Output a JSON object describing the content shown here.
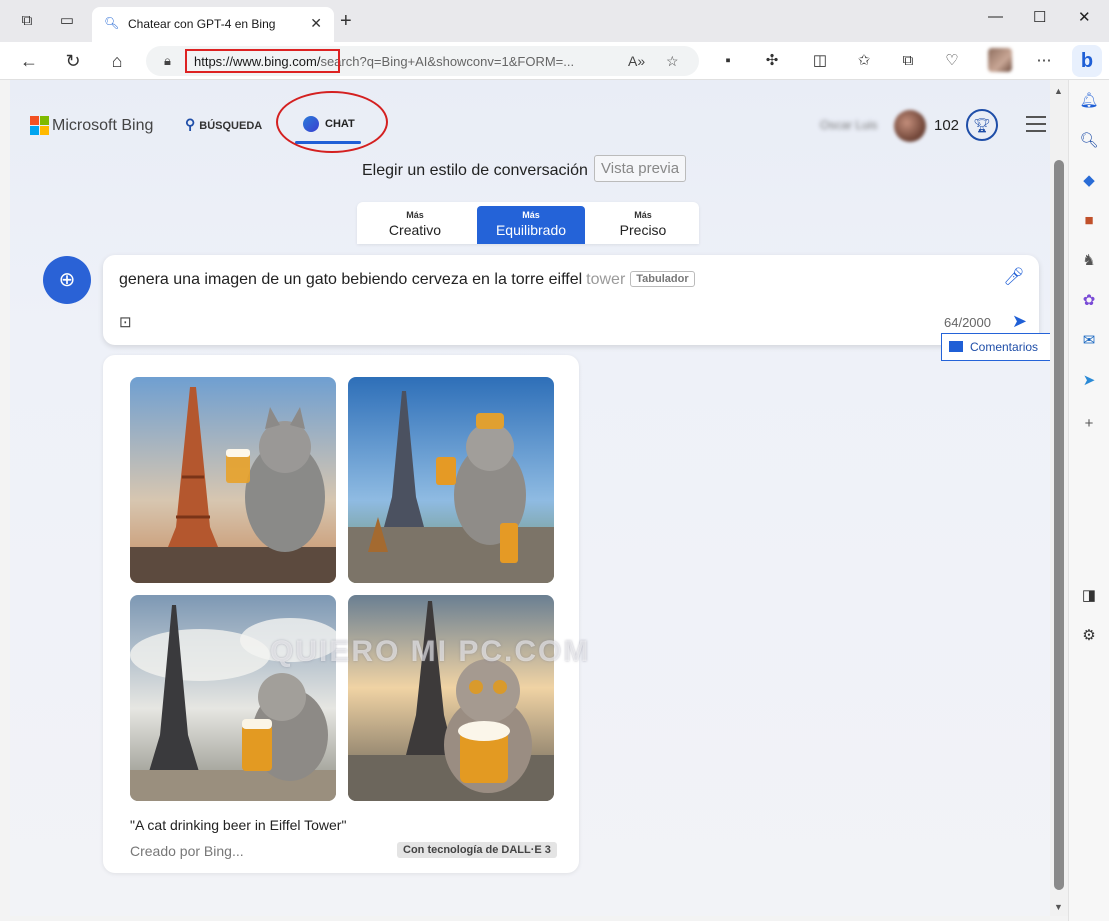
{
  "browser": {
    "tab_title": "Chatear con GPT-4 en Bing",
    "url_host": "https://www.bing.com/",
    "url_rest": "search?q=Bing+AI&showconv=1&FORM=...",
    "new_tab": "+",
    "window_controls": [
      "minimize-icon",
      "maximize-icon",
      "close-icon"
    ]
  },
  "bing": {
    "brand": "Microsoft Bing",
    "nav": {
      "search": "BÚSQUEDA",
      "chat": "CHAT"
    },
    "user": {
      "name": "Oscar Luis",
      "points": "102"
    }
  },
  "conversation_style": {
    "label": "Elegir un estilo de conversación",
    "badge": "Vista previa",
    "tones": [
      {
        "small": "Más",
        "label": "Creativo",
        "active": false
      },
      {
        "small": "Más",
        "label": "Equilibrado",
        "active": true
      },
      {
        "small": "Más",
        "label": "Preciso",
        "active": false
      }
    ]
  },
  "input": {
    "text": "genera una imagen de un gato bebiendo cerveza en la torre eiffel",
    "suggestion": "tower",
    "tab_hint": "Tabulador",
    "counter": "64/2000"
  },
  "feedback": {
    "label": "Comentarios"
  },
  "result": {
    "caption": "\"A cat drinking beer in Eiffel Tower\"",
    "credit": "Creado por Bing...",
    "powered_by": "Con tecnología de DALL·E 3",
    "images": [
      {
        "alt": "cat-beer-eiffel-1"
      },
      {
        "alt": "cat-beer-eiffel-2"
      },
      {
        "alt": "cat-beer-eiffel-3"
      },
      {
        "alt": "cat-beer-eiffel-4"
      }
    ]
  },
  "watermark": "QUIERO MI PC.COM",
  "colors": {
    "accent": "#2463d8",
    "highlight_red": "#d42020"
  }
}
